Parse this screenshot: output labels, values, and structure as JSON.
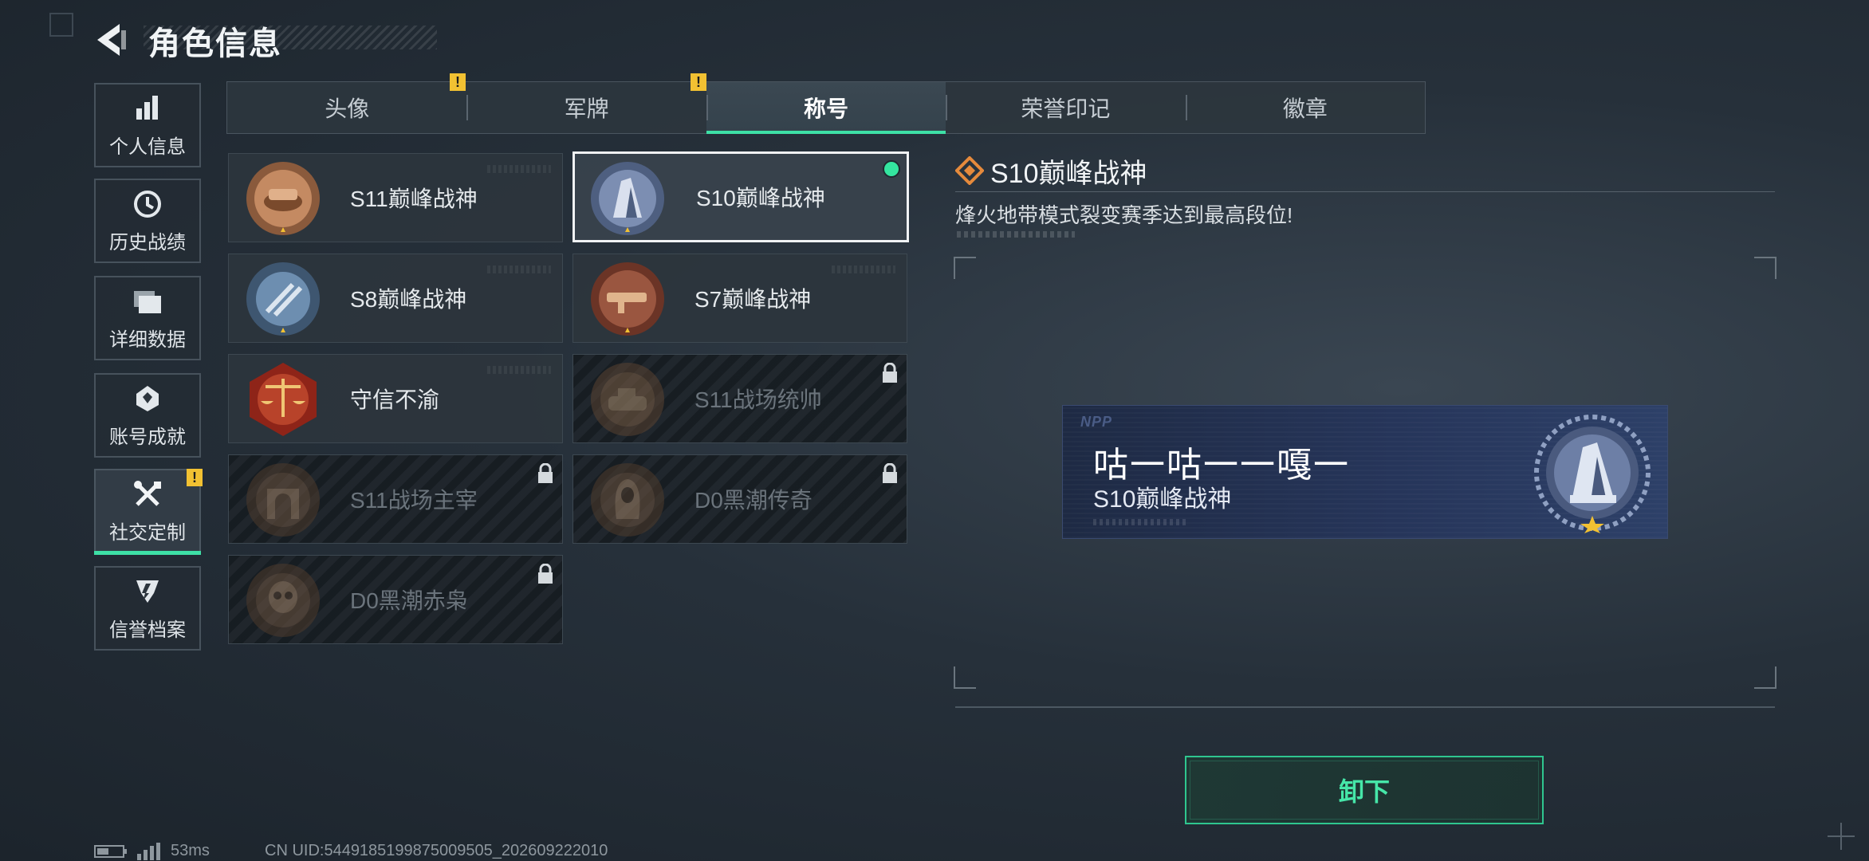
{
  "header": {
    "title": "角色信息"
  },
  "sidebar": {
    "items": [
      {
        "label": "个人信息",
        "icon": "bar-chart-icon"
      },
      {
        "label": "历史战绩",
        "icon": "history-clock-icon"
      },
      {
        "label": "详细数据",
        "icon": "folder-icon"
      },
      {
        "label": "账号成就",
        "icon": "achievement-icon"
      },
      {
        "label": "社交定制",
        "icon": "tools-icon",
        "active": true,
        "warning": "!"
      },
      {
        "label": "信誉档案",
        "icon": "credit-shield-icon"
      }
    ]
  },
  "tabs": [
    {
      "label": "头像",
      "warning": ""
    },
    {
      "label": "军牌",
      "warning": "!"
    },
    {
      "label": "称号",
      "active": true,
      "warning": "!"
    },
    {
      "label": "荣誉印记"
    },
    {
      "label": "徽章"
    }
  ],
  "titles": [
    {
      "name": "S11巅峰战神",
      "locked": false
    },
    {
      "name": "S10巅峰战神",
      "locked": false,
      "selected": true,
      "equipped": true
    },
    {
      "name": "S8巅峰战神",
      "locked": false
    },
    {
      "name": "S7巅峰战神",
      "locked": false
    },
    {
      "name": "守信不渝",
      "locked": false
    },
    {
      "name": "S11战场统帅",
      "locked": true
    },
    {
      "name": "S11战场主宰",
      "locked": true
    },
    {
      "name": "D0黑潮传奇",
      "locked": true
    },
    {
      "name": "D0黑潮赤枭",
      "locked": true
    }
  ],
  "detail": {
    "title": "S10巅峰战神",
    "description": "烽火地带模式裂变赛季达到最高段位!"
  },
  "preview": {
    "logo": "NPP",
    "player_name": "咕一咕一一嘎一",
    "title": "S10巅峰战神"
  },
  "actions": {
    "unequip_label": "卸下"
  },
  "status_bar": {
    "ping": "53ms",
    "uid": "CN UID:5449185199875009505_202609222010"
  },
  "colors": {
    "accent": "#3ee0a6",
    "warning": "#f2c132",
    "equipped_dot": "#34e59f"
  }
}
